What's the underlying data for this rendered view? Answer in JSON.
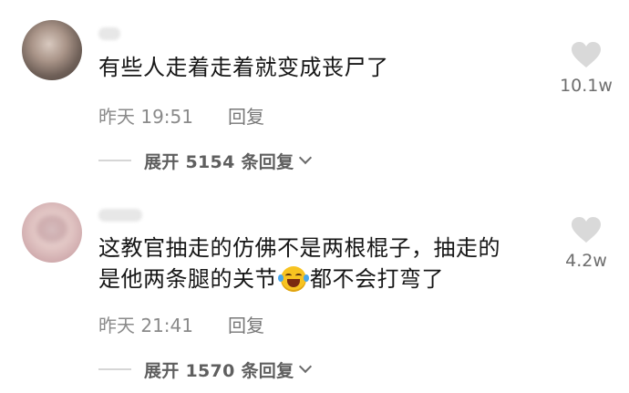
{
  "comments": [
    {
      "username": "",
      "text": "有些人走着走着就变成丧尸了",
      "time": "昨天 19:51",
      "reply_label": "回复",
      "expand_label": "展开 5154 条回复",
      "likes": "10.1w",
      "icons": {
        "like": "heart-icon",
        "expand": "chevron-down-icon"
      }
    },
    {
      "username": "",
      "text_line1": "这教官抽走的仿佛不是两根棍子，抽走的",
      "text_line2_before": "是他两条腿的关节",
      "emoji": "laughing-crying-emoji",
      "text_line2_after": "都不会打弯了",
      "time": "昨天 21:41",
      "reply_label": "回复",
      "expand_label": "展开 1570 条回复",
      "likes": "4.2w",
      "icons": {
        "like": "heart-icon",
        "expand": "chevron-down-icon"
      }
    }
  ],
  "colors": {
    "heart": "#d9d9d9",
    "text": "#161616",
    "meta": "#8a8a8a"
  }
}
